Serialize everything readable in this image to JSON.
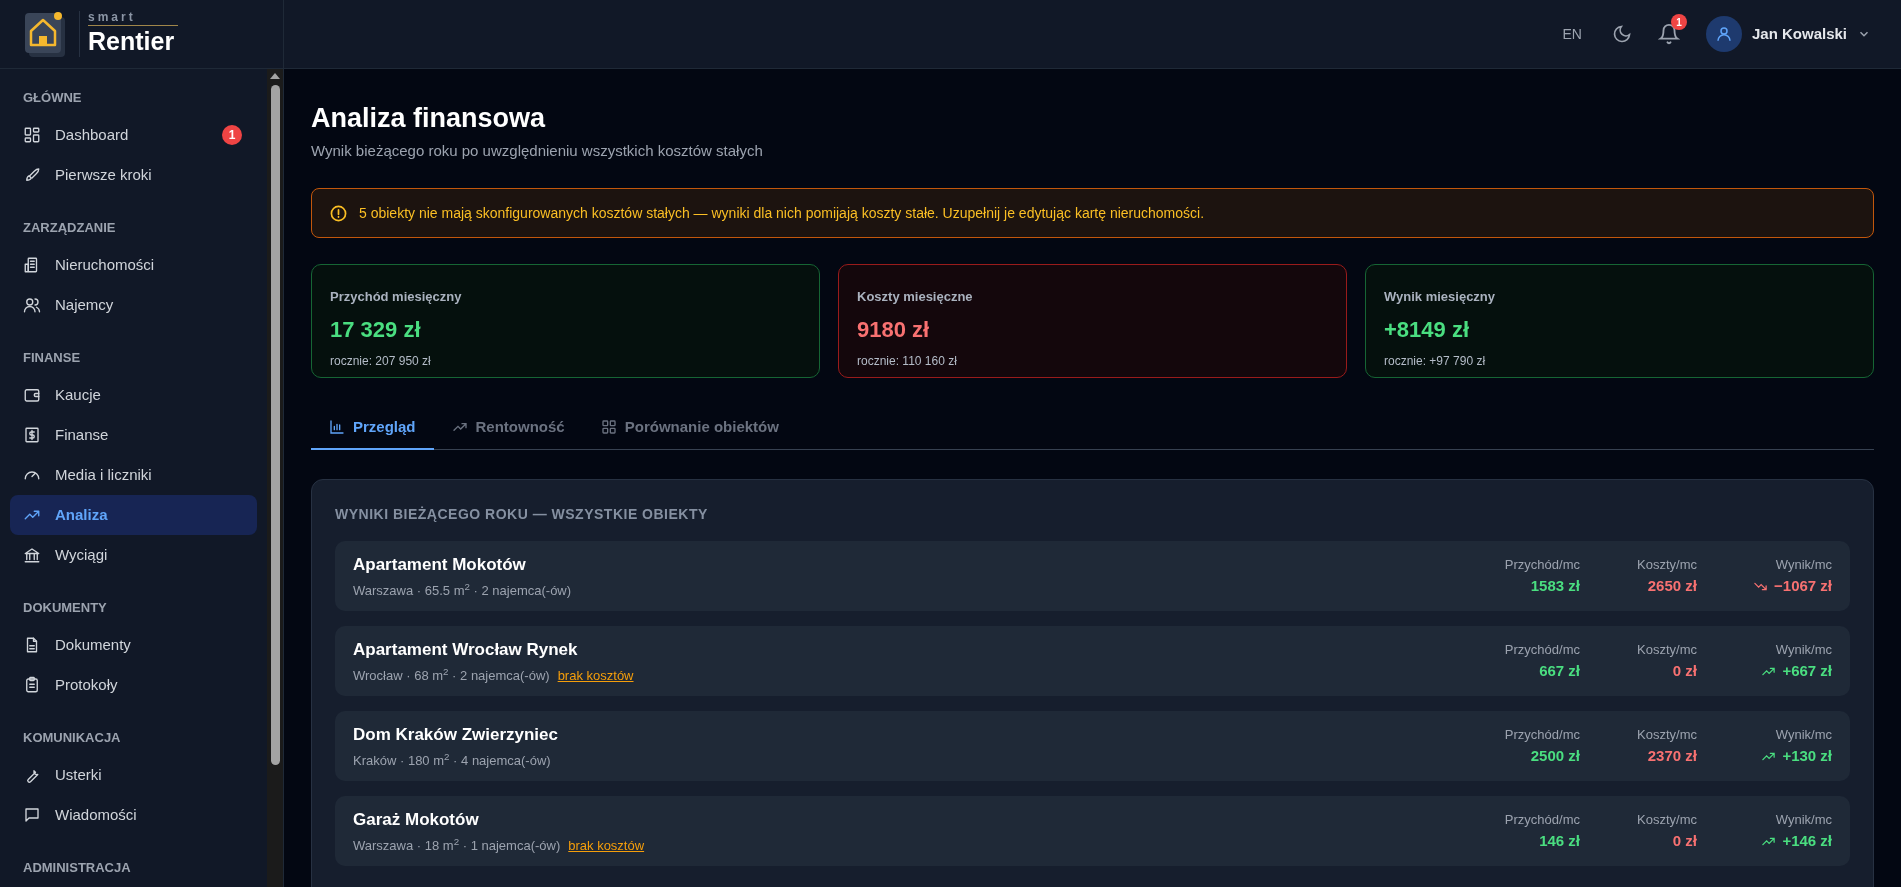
{
  "brand": {
    "small": "smart",
    "name": "Rentier"
  },
  "header": {
    "language": "EN",
    "notifications_badge": "1",
    "user_name": "Jan Kowalski"
  },
  "sidebar": {
    "sections": [
      {
        "label": "GŁÓWNE",
        "items": [
          {
            "label": "Dashboard",
            "selected": false,
            "badge": "1"
          },
          {
            "label": "Pierwsze kroki",
            "selected": false
          }
        ]
      },
      {
        "label": "ZARZĄDZANIE",
        "items": [
          {
            "label": "Nieruchomości",
            "selected": false
          },
          {
            "label": "Najemcy",
            "selected": false
          }
        ]
      },
      {
        "label": "FINANSE",
        "items": [
          {
            "label": "Kaucje",
            "selected": false
          },
          {
            "label": "Finanse",
            "selected": false
          },
          {
            "label": "Media i liczniki",
            "selected": false
          },
          {
            "label": "Analiza",
            "selected": true
          },
          {
            "label": "Wyciągi",
            "selected": false
          }
        ]
      },
      {
        "label": "DOKUMENTY",
        "items": [
          {
            "label": "Dokumenty",
            "selected": false
          },
          {
            "label": "Protokoły",
            "selected": false
          }
        ]
      },
      {
        "label": "KOMUNIKACJA",
        "items": [
          {
            "label": "Usterki",
            "selected": false
          },
          {
            "label": "Wiadomości",
            "selected": false
          }
        ]
      },
      {
        "label": "ADMINISTRACJA"
      }
    ]
  },
  "page": {
    "title": "Analiza finansowa",
    "subtitle": "Wynik bieżącego roku po uwzględnieniu wszystkich kosztów stałych"
  },
  "alert": {
    "text": "5 obiekty nie mają skonfigurowanych kosztów stałych — wyniki dla nich pomijają koszty stałe. Uzupełnij je edytując kartę nieruchomości."
  },
  "summary_cards": [
    {
      "kind": "income",
      "label": "Przychód miesięczny",
      "value": "17 329 zł",
      "yearly": "rocznie: 207 950 zł"
    },
    {
      "kind": "cost",
      "label": "Koszty miesięczne",
      "value": "9180 zł",
      "yearly": "rocznie: 110 160 zł"
    },
    {
      "kind": "result",
      "label": "Wynik miesięczny",
      "value": "+8149 zł",
      "yearly": "rocznie: +97 790 zł"
    }
  ],
  "tabs": [
    {
      "label": "Przegląd",
      "selected": true
    },
    {
      "label": "Rentowność",
      "selected": false
    },
    {
      "label": "Porównanie obiektów",
      "selected": false
    }
  ],
  "results": {
    "heading": "WYNIKI BIEŻĄCEGO ROKU — WSZYSTKIE OBIEKTY",
    "rows": [
      {
        "name": "Apartament Mokotów",
        "meta": "Warszawa · 65.5 m$^{2}$ · 2 najemca(-ów)",
        "missing_costs": null,
        "income_label": "Przychód/mc",
        "income": "1583 zł",
        "costs_label": "Koszty/mc",
        "costs": "2650 zł",
        "result_label": "Wynik/mc",
        "result": "−1067 zł",
        "kind": "down"
      },
      {
        "name": "Apartament Wrocław Rynek",
        "meta": "Wrocław · 68 m$^{2}$ · 2 najemca(-ów)",
        "missing_costs": "brak kosztów",
        "income_label": "Przychód/mc",
        "income": "667 zł",
        "costs_label": "Koszty/mc",
        "costs": "0 zł",
        "result_label": "Wynik/mc",
        "result": "+667 zł",
        "kind": "up"
      },
      {
        "name": "Dom Kraków Zwierzyniec",
        "meta": "Kraków · 180 m$^{2}$ · 4 najemca(-ów)",
        "missing_costs": null,
        "income_label": "Przychód/mc",
        "income": "2500 zł",
        "costs_label": "Koszty/mc",
        "costs": "2370 zł",
        "result_label": "Wynik/mc",
        "result": "+130 zł",
        "kind": "up"
      },
      {
        "name": "Garaż Mokotów",
        "meta": "Warszawa · 18 m$^{2}$ · 1 najemca(-ów)",
        "missing_costs": "brak kosztów",
        "income_label": "Przychód/mc",
        "income": "146 zł",
        "costs_label": "Koszty/mc",
        "costs": "0 zł",
        "result_label": "Wynik/mc",
        "result": "+146 zł",
        "kind": "up"
      }
    ]
  }
}
